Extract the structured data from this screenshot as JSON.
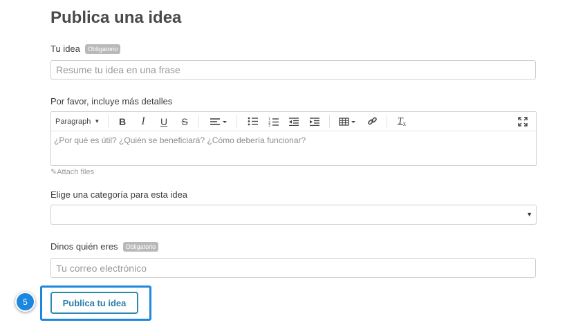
{
  "page": {
    "title": "Publica una idea"
  },
  "idea": {
    "label": "Tu idea",
    "badge": "Obligatorio",
    "placeholder": "Resume tu idea en una frase"
  },
  "details": {
    "label": "Por favor, incluye más detalles",
    "paragraph": "Paragraph",
    "placeholder": "¿Por qué es útil? ¿Quién se beneficiará? ¿Cómo debería funcionar?",
    "attach": "Attach files"
  },
  "toolbar_icons": [
    "bold-icon",
    "italic-icon",
    "underline-icon",
    "strikethrough-icon",
    "align-icon",
    "bullet-list-icon",
    "numbered-list-icon",
    "outdent-icon",
    "indent-icon",
    "table-icon",
    "link-icon",
    "clear-format-icon",
    "fullscreen-icon"
  ],
  "category": {
    "label": "Elige una categoría para esta idea",
    "value": ""
  },
  "contact": {
    "label": "Dinos quién eres",
    "badge": "Obligatorio",
    "placeholder": "Tu correo electrónico"
  },
  "submit": {
    "label": "Publica tu idea"
  },
  "step": {
    "number": "5"
  },
  "colors": {
    "accent": "#1d87e0",
    "button": "#2b8ab5",
    "badge": "#b9b9b9"
  }
}
